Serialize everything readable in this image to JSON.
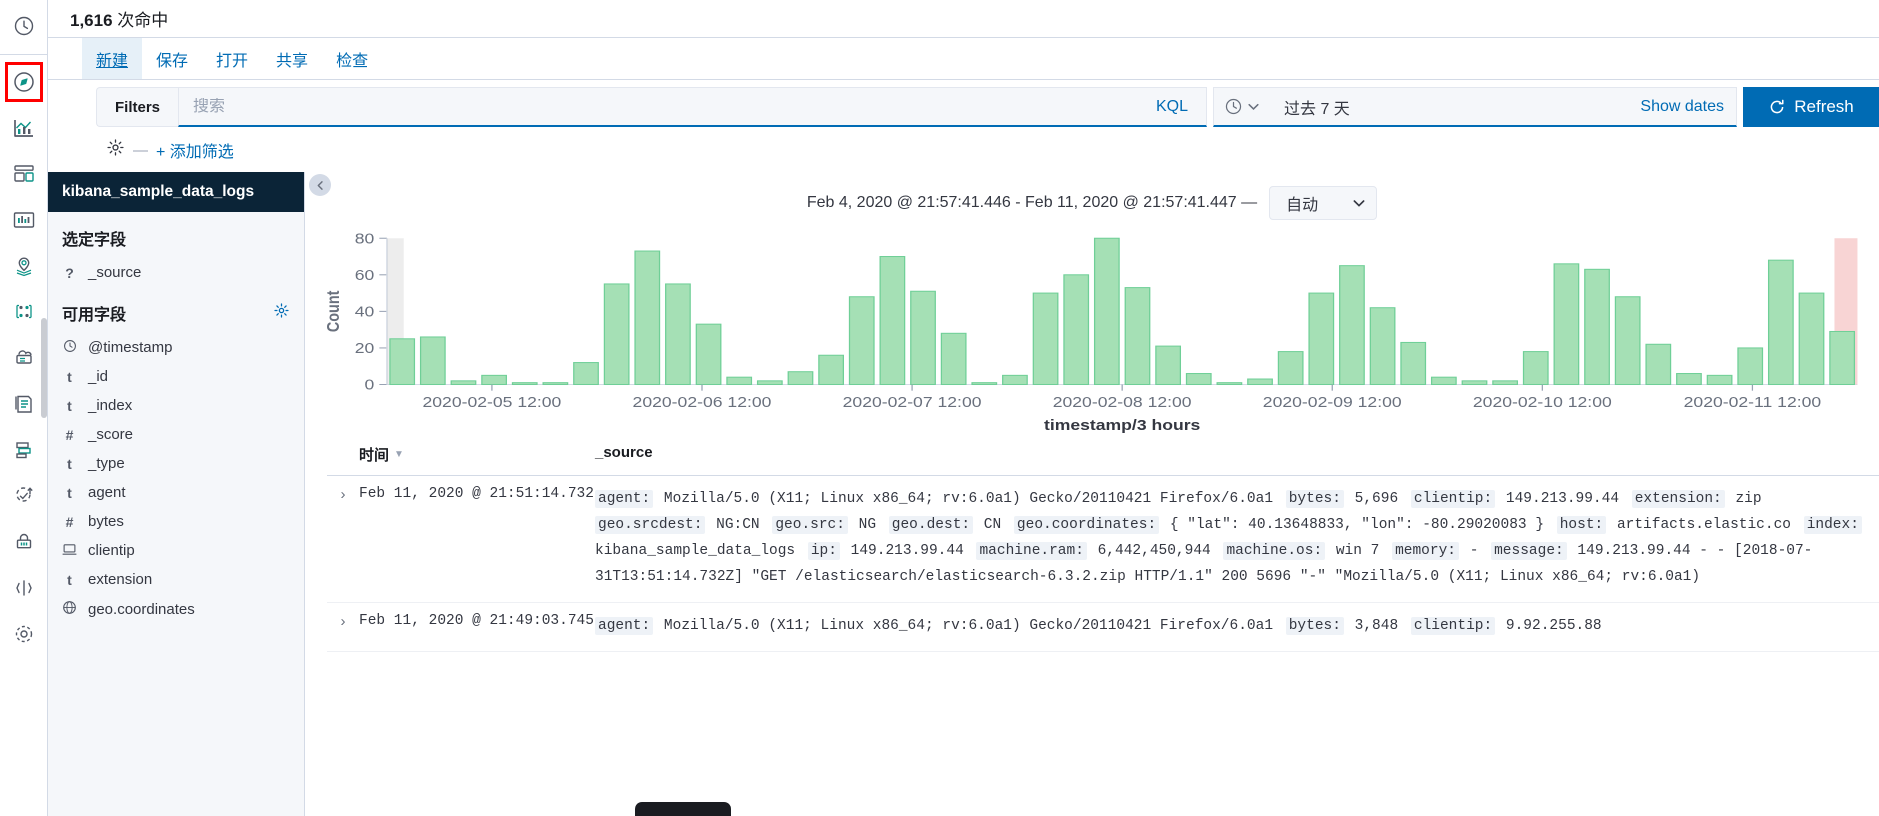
{
  "rail": {
    "items": [
      {
        "name": "recently-viewed-icon",
        "label": "Recently viewed"
      },
      {
        "name": "discover-icon",
        "label": "Discover",
        "selected": true
      },
      {
        "name": "visualize-icon",
        "label": "Visualize"
      },
      {
        "name": "dashboard-icon",
        "label": "Dashboard"
      },
      {
        "name": "canvas-icon",
        "label": "Canvas"
      },
      {
        "name": "maps-icon",
        "label": "Maps"
      },
      {
        "name": "machine-learning-icon",
        "label": "Machine Learning"
      },
      {
        "name": "infrastructure-icon",
        "label": "Infrastructure"
      },
      {
        "name": "logs-icon",
        "label": "Logs"
      },
      {
        "name": "apm-icon",
        "label": "APM"
      },
      {
        "name": "uptime-icon",
        "label": "Uptime"
      },
      {
        "name": "siem-icon",
        "label": "SIEM"
      },
      {
        "name": "dev-tools-icon",
        "label": "Dev Tools"
      },
      {
        "name": "management-icon",
        "label": "Management"
      }
    ]
  },
  "hits": {
    "count": "1,616",
    "suffix": " 次命中"
  },
  "menu": {
    "items": [
      {
        "label": "新建",
        "name": "menu-new",
        "active": true
      },
      {
        "label": "保存",
        "name": "menu-save",
        "active": false
      },
      {
        "label": "打开",
        "name": "menu-open",
        "active": false
      },
      {
        "label": "共享",
        "name": "menu-share",
        "active": false
      },
      {
        "label": "检查",
        "name": "menu-inspect",
        "active": false
      }
    ]
  },
  "query_bar": {
    "filters_label": "Filters",
    "search_placeholder": "搜索",
    "search_value": "",
    "language_label": "KQL",
    "date_range_label": "过去 7 天",
    "show_dates_label": "Show dates",
    "refresh_label": "Refresh"
  },
  "filter_bar": {
    "add_filter_label": "+ 添加筛选"
  },
  "sidebar": {
    "index_pattern": "kibana_sample_data_logs",
    "selected_fields_title": "选定字段",
    "available_fields_title": "可用字段",
    "selected_fields": [
      {
        "icon": "?",
        "name": "_source"
      }
    ],
    "available_fields": [
      {
        "icon": "clock",
        "name": "@timestamp"
      },
      {
        "icon": "t",
        "name": "_id"
      },
      {
        "icon": "t",
        "name": "_index"
      },
      {
        "icon": "#",
        "name": "_score"
      },
      {
        "icon": "t",
        "name": "_type"
      },
      {
        "icon": "t",
        "name": "agent"
      },
      {
        "icon": "#",
        "name": "bytes"
      },
      {
        "icon": "ip",
        "name": "clientip"
      },
      {
        "icon": "t",
        "name": "extension"
      },
      {
        "icon": "geo",
        "name": "geo.coordinates"
      }
    ]
  },
  "chart_panel": {
    "time_range_text": "Feb 4, 2020 @ 21:57:41.446 - Feb 11, 2020 @ 21:57:41.447 —",
    "interval_value": "自动"
  },
  "chart_data": {
    "type": "bar",
    "title": "",
    "xlabel": "timestamp/3 hours",
    "ylabel": "Count",
    "ylim": [
      0,
      80
    ],
    "yticks": [
      0,
      20,
      40,
      60,
      80
    ],
    "grid": false,
    "legend": null,
    "xticks": [
      "2020-02-05 12:00",
      "2020-02-06 12:00",
      "2020-02-07 12:00",
      "2020-02-08 12:00",
      "2020-02-09 12:00",
      "2020-02-10 12:00",
      "2020-02-11 12:00"
    ],
    "bar_color": "#a5e0b5",
    "bar_stroke": "#6fcf97",
    "values": [
      25,
      26,
      2,
      5,
      1,
      1,
      12,
      55,
      73,
      55,
      33,
      4,
      2,
      7,
      16,
      48,
      70,
      51,
      28,
      1,
      5,
      50,
      60,
      80,
      53,
      21,
      6,
      1,
      3,
      18,
      50,
      65,
      42,
      23,
      4,
      2,
      2,
      18,
      66,
      63,
      48,
      22,
      6,
      5,
      20,
      68,
      50,
      29
    ]
  },
  "doc_table": {
    "columns": {
      "time": "时间",
      "source": "_source"
    },
    "rows": [
      {
        "time": "Feb 11, 2020 @ 21:51:14.732",
        "fields": [
          {
            "key": "agent:",
            "value": "Mozilla/5.0 (X11; Linux x86_64; rv:6.0a1) Gecko/20110421 Firefox/6.0a1"
          },
          {
            "key": "bytes:",
            "value": "5,696"
          },
          {
            "key": "clientip:",
            "value": "149.213.99.44"
          },
          {
            "key": "extension:",
            "value": "zip"
          },
          {
            "key": "geo.srcdest:",
            "value": "NG:CN"
          },
          {
            "key": "geo.src:",
            "value": "NG"
          },
          {
            "key": "geo.dest:",
            "value": "CN"
          },
          {
            "key": "geo.coordinates:",
            "value": "{ \"lat\": 40.13648833, \"lon\": -80.29020083 }"
          },
          {
            "key": "host:",
            "value": "artifacts.elastic.co"
          },
          {
            "key": "index:",
            "value": "kibana_sample_data_logs"
          },
          {
            "key": "ip:",
            "value": "149.213.99.44"
          },
          {
            "key": "machine.ram:",
            "value": "6,442,450,944"
          },
          {
            "key": "machine.os:",
            "value": "win 7"
          },
          {
            "key": "memory:",
            "value": "-"
          },
          {
            "key": "message:",
            "value": "149.213.99.44 - - [2018-07-31T13:51:14.732Z] \"GET /elasticsearch/elasticsearch-6.3.2.zip HTTP/1.1\" 200 5696 \"-\" \"Mozilla/5.0 (X11; Linux x86_64; rv:6.0a1)"
          }
        ]
      },
      {
        "time": "Feb 11, 2020 @ 21:49:03.745",
        "fields": [
          {
            "key": "agent:",
            "value": "Mozilla/5.0 (X11; Linux x86_64; rv:6.0a1) Gecko/20110421 Firefox/6.0a1"
          },
          {
            "key": "bytes:",
            "value": "3,848"
          },
          {
            "key": "clientip:",
            "value": "9.92.255.88"
          }
        ]
      }
    ]
  }
}
